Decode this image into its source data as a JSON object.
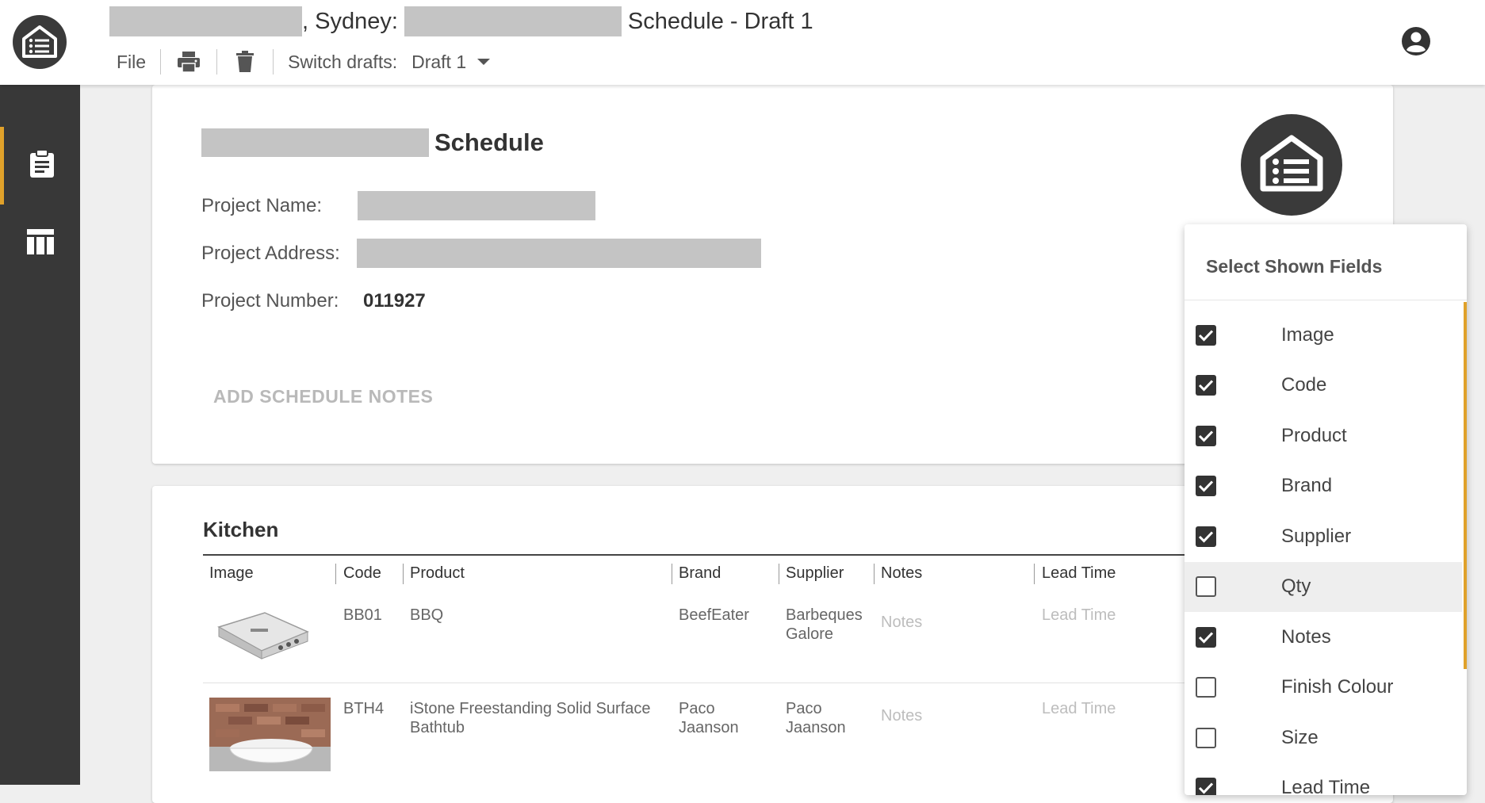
{
  "header": {
    "title_sep": ", Sydney:",
    "title_suffix": "Schedule - Draft 1",
    "menu_file": "File",
    "switch_drafts_label": "Switch drafts:",
    "current_draft": "Draft 1"
  },
  "schedule": {
    "title": "Schedule",
    "project_name_label": "Project Name:",
    "project_address_label": "Project Address:",
    "project_number_label": "Project Number:",
    "project_number": "011927",
    "add_notes": "ADD SCHEDULE NOTES"
  },
  "kitchen": {
    "title": "Kitchen",
    "columns": [
      "Image",
      "Code",
      "Product",
      "Brand",
      "Supplier",
      "Notes",
      "Lead Time"
    ],
    "rows": [
      {
        "code": "BB01",
        "product": "BBQ",
        "brand": "BeefEater",
        "supplier": "Barbeques Galore",
        "notes": "Notes",
        "lead_time": "Lead Time"
      },
      {
        "code": "BTH4",
        "product": "iStone Freestanding Solid Surface Bathtub",
        "brand": "Paco Jaanson",
        "supplier": "Paco Jaanson",
        "notes": "Notes",
        "lead_time": "Lead Time"
      }
    ]
  },
  "fields_panel": {
    "title": "Select Shown Fields",
    "items": [
      {
        "label": "Image",
        "checked": true
      },
      {
        "label": "Code",
        "checked": true
      },
      {
        "label": "Product",
        "checked": true
      },
      {
        "label": "Brand",
        "checked": true
      },
      {
        "label": "Supplier",
        "checked": true
      },
      {
        "label": "Qty",
        "checked": false
      },
      {
        "label": "Notes",
        "checked": true
      },
      {
        "label": "Finish Colour",
        "checked": false
      },
      {
        "label": "Size",
        "checked": false
      },
      {
        "label": "Lead Time",
        "checked": true
      }
    ]
  },
  "colors": {
    "accent": "#e0a12a",
    "sidebar": "#383838"
  }
}
